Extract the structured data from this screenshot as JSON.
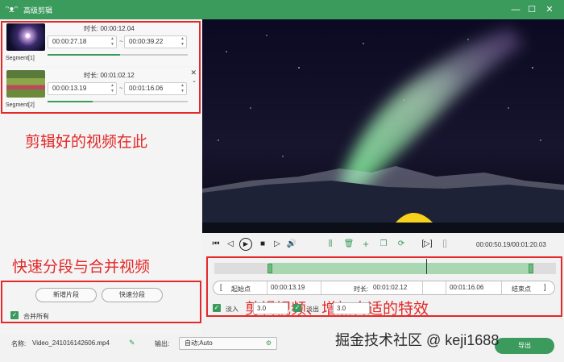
{
  "app": {
    "title": "高级剪辑",
    "icon": "rabbit-icon"
  },
  "window_controls": [
    "minimize-icon",
    "maximize-icon",
    "close-icon"
  ],
  "segments": [
    {
      "label": "Segment[1]",
      "duration_label": "时长:",
      "duration": "00:00:12.04",
      "start": "00:00:27.18",
      "end": "00:00:39.22",
      "separator": "~",
      "progress": 0.52
    },
    {
      "label": "Segment[2]",
      "duration_label": "时长:",
      "duration": "00:01:02.12",
      "start": "00:00:13.19",
      "end": "00:01:16.06",
      "separator": "~",
      "progress": 0.32
    }
  ],
  "annotations": {
    "segments": "剪辑好的视频在此",
    "split_merge": "快速分段与合并视频",
    "effects": "剪辑视频、增加合适的特效"
  },
  "segment_actions": {
    "new_segment": "新增片段",
    "quick_split": "快速分段",
    "merge_all": "合并所有"
  },
  "player": {
    "time_current": "00:00:50.19",
    "time_total": "00:01:20.03",
    "time_separator": "/",
    "playhead": 0.62
  },
  "trim": {
    "start_label": "起始点",
    "start_value": "00:00:13.19",
    "duration_label": "时长:",
    "duration_value": "00:01:02.12",
    "end_value": "00:01:16.06",
    "end_label": "结束点"
  },
  "fade": {
    "in_label": "淡入",
    "in_value": "3.0",
    "out_label": "淡出",
    "out_value": "3.0"
  },
  "bottom": {
    "name_label": "名称:",
    "name_value": "Video_241016142606.mp4",
    "output_label": "输出:",
    "output_value": "自动;Auto",
    "export_label": "导出"
  },
  "watermark": "掘金技术社区 @ keji1688",
  "colors": {
    "accent": "#3a9b5c",
    "annotation": "#e32929"
  }
}
